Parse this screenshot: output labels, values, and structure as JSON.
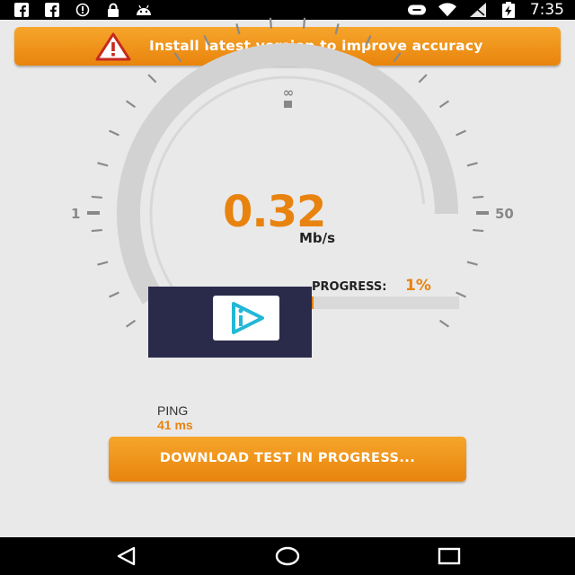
{
  "status_bar": {
    "left_icons": [
      "facebook-icon",
      "facebook-icon",
      "data-saver-icon",
      "lock-icon",
      "android-icon"
    ],
    "right_icons": [
      "toggle-icon",
      "wifi-icon",
      "signal-icon",
      "battery-charging-icon"
    ],
    "time": "7:35"
  },
  "banner": {
    "icon": "warning-icon",
    "text": "Install latest version to improve accuracy"
  },
  "gauge": {
    "speed_value": "0.32",
    "speed_unit": "Mb/s",
    "min_label": "1",
    "max_label": "50",
    "top_label": "∞",
    "fill_fraction": 0.72
  },
  "progress": {
    "label": "PROGRESS:",
    "value_text": "1%",
    "value": 0.01
  },
  "ad": {
    "logo_icon": "play-logo-icon"
  },
  "ping": {
    "label": "PING",
    "value": "41 ms"
  },
  "download_button": {
    "label": "DOWNLOAD TEST IN PROGRESS..."
  },
  "nav_bar": {
    "icons": [
      "back-icon",
      "home-icon",
      "recents-icon"
    ]
  },
  "colors": {
    "accent": "#e8830f",
    "background": "#e9e9e9"
  }
}
